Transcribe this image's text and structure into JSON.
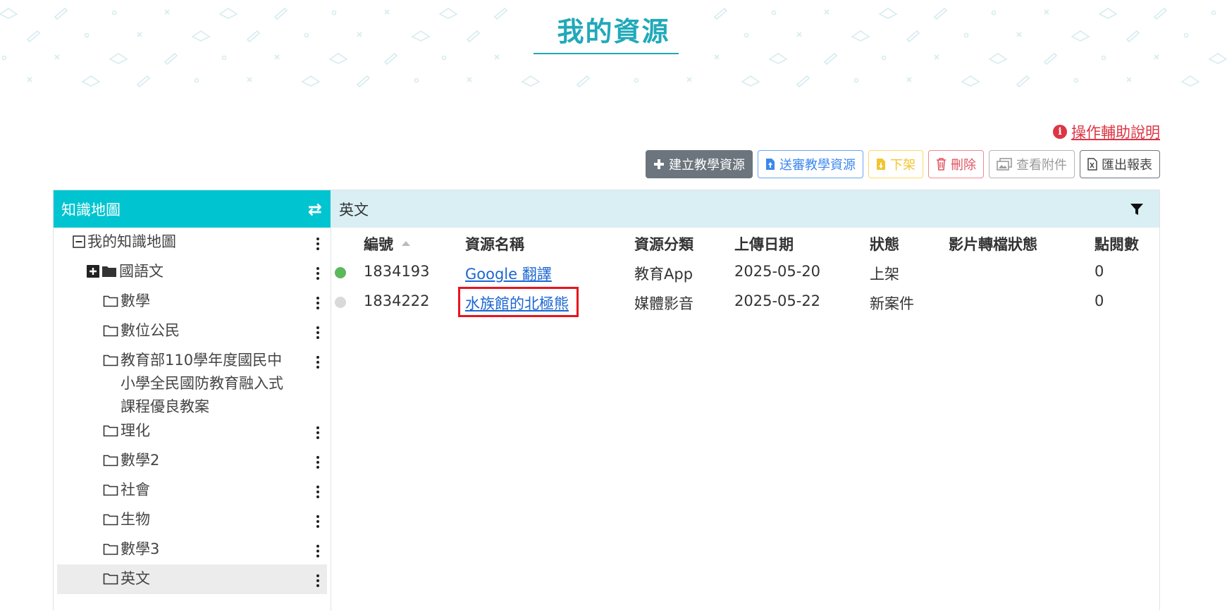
{
  "page": {
    "title": "我的資源",
    "help_label": "操作輔助說明"
  },
  "toolbar": {
    "create_label": "建立教學資源",
    "submit_label": "送審教學資源",
    "unpublish_label": "下架",
    "delete_label": "刪除",
    "attachments_label": "查看附件",
    "export_label": "匯出報表"
  },
  "tree": {
    "header": "知識地圖",
    "items": [
      {
        "label": "我的知識地圖"
      },
      {
        "label": "國語文"
      },
      {
        "label": "數學"
      },
      {
        "label": "數位公民"
      },
      {
        "label": "教育部110學年度國民中",
        "label2": "小學全民國防教育融入式",
        "label3": "課程優良教案"
      },
      {
        "label": "理化"
      },
      {
        "label": "數學2"
      },
      {
        "label": "社會"
      },
      {
        "label": "生物"
      },
      {
        "label": "數學3"
      },
      {
        "label": "英文"
      }
    ]
  },
  "content": {
    "category": "英文",
    "columns": {
      "id": "編號",
      "name": "資源名稱",
      "type": "資源分類",
      "date": "上傳日期",
      "status": "狀態",
      "video": "影片轉檔狀態",
      "views": "點閱數"
    },
    "rows": [
      {
        "id": "1834193",
        "name": "Google 翻譯",
        "type": "教育App",
        "date": "2025-05-20",
        "status": "上架",
        "video": "",
        "views": "0",
        "dot_color": "#5cb85c"
      },
      {
        "id": "1834222",
        "name": "水族館的北極熊",
        "type": "媒體影音",
        "date": "2025-05-22",
        "status": "新案件",
        "video": "",
        "views": "0",
        "dot_color": "#d9d9d9"
      }
    ]
  },
  "colors": {
    "brand": "#20a9b9",
    "header_cyan": "#00c5d1",
    "highlight": "#e8141c"
  }
}
